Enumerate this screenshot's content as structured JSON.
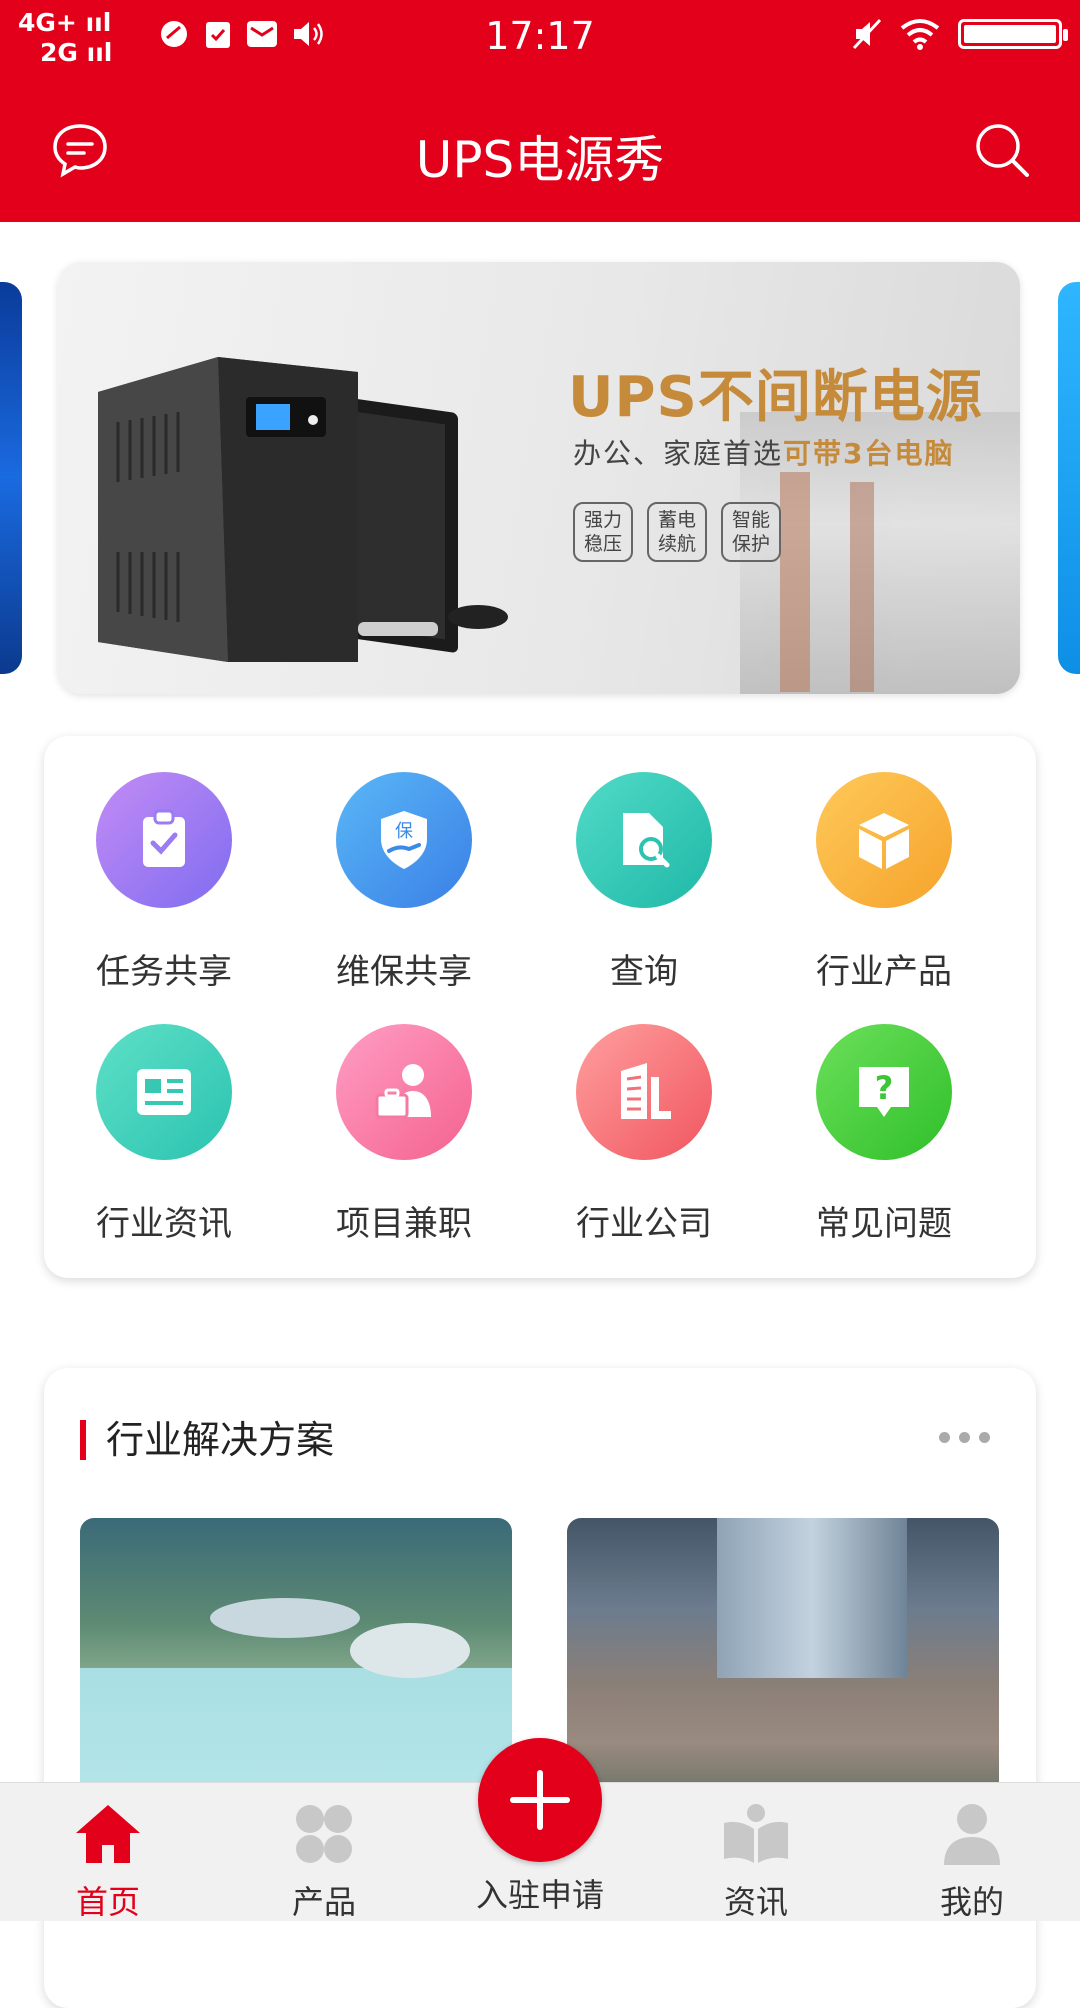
{
  "status_bar": {
    "network_line1": "4G+",
    "network_line2": "2G",
    "time": "17:17"
  },
  "header": {
    "title": "UPS电源秀",
    "background_color": "#e2001a"
  },
  "banner": {
    "headline": "UPS不间断电源",
    "subtitle_prefix": "办公、家庭首选",
    "subtitle_highlight": "可带3台电脑",
    "tags": [
      "强力稳压",
      "蓄电续航",
      "智能保护"
    ]
  },
  "grid": {
    "items": [
      {
        "label": "任务共享",
        "icon": "clipboard-check-icon",
        "color_from": "#c38cf5",
        "color_to": "#7f6cf0"
      },
      {
        "label": "维保共享",
        "icon": "shield-hand-icon",
        "color_from": "#5ab8f7",
        "color_to": "#3a7fe6"
      },
      {
        "label": "查询",
        "icon": "document-search-icon",
        "color_from": "#52dbc8",
        "color_to": "#1fb8a7"
      },
      {
        "label": "行业产品",
        "icon": "box-icon",
        "color_from": "#ffc95a",
        "color_to": "#f5a32b"
      },
      {
        "label": "行业资讯",
        "icon": "news-icon",
        "color_from": "#5fe0c7",
        "color_to": "#2ac3b0"
      },
      {
        "label": "项目兼职",
        "icon": "person-briefcase-icon",
        "color_from": "#ff9ec4",
        "color_to": "#f4628f"
      },
      {
        "label": "行业公司",
        "icon": "building-icon",
        "color_from": "#ff9f9f",
        "color_to": "#f0565f"
      },
      {
        "label": "常见问题",
        "icon": "question-bubble-icon",
        "color_from": "#6ce05a",
        "color_to": "#2fbf2a"
      }
    ]
  },
  "solutions": {
    "title": "行业解决方案"
  },
  "bottom_nav": {
    "items": [
      {
        "label": "首页",
        "icon": "home-icon",
        "active": true
      },
      {
        "label": "产品",
        "icon": "grid-four-icon",
        "active": false
      },
      {
        "label": "资讯",
        "icon": "book-reader-icon",
        "active": false
      },
      {
        "label": "我的",
        "icon": "user-icon",
        "active": false
      }
    ],
    "center_label": "入驻申请"
  }
}
